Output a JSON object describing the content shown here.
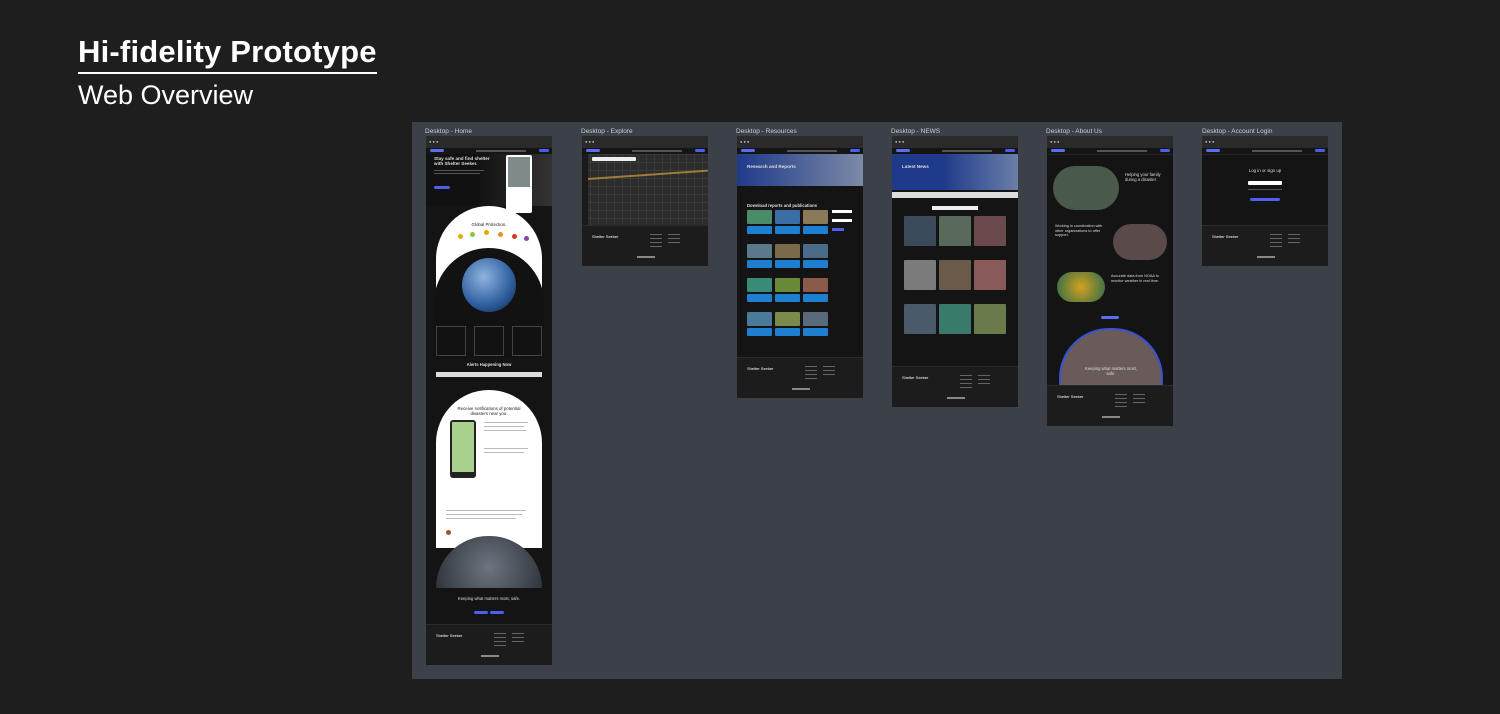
{
  "header": {
    "title": "Hi-fidelity Prototype",
    "subtitle": "Web Overview"
  },
  "frames": [
    {
      "id": "home",
      "label": "Desktop - Home"
    },
    {
      "id": "explore",
      "label": "Desktop - Explore"
    },
    {
      "id": "resources",
      "label": "Desktop - Resources"
    },
    {
      "id": "news",
      "label": "Desktop - NEWS"
    },
    {
      "id": "about",
      "label": "Desktop - About Us"
    },
    {
      "id": "login",
      "label": "Desktop - Account Login"
    }
  ],
  "home": {
    "hero": "Stay safe and find shelter with Shelter Seeker.",
    "global": "Global Protection.",
    "alerts": "Alerts Happening Now",
    "notify": "Receive notifications of potential disasters near you.",
    "keeping": "Keeping what matters most, safe."
  },
  "resources": {
    "title": "Research and Reports",
    "download": "Download reports and publications"
  },
  "news": {
    "title": "Latest News"
  },
  "about": {
    "helping": "Helping your family during a disaster.",
    "working": "Working in coordination with other organizations to offer support.",
    "accurate": "Accurate data from NOAA to monitor weather in real time.",
    "keeping": "Keeping what matters most, safe."
  },
  "login": {
    "title": "Log in or sign up"
  },
  "footer": {
    "brand": "Shelter Seeker"
  },
  "colors": {
    "accent": "#4b5ff0",
    "canvas": "#3b4049",
    "background": "#1e1e1e"
  }
}
